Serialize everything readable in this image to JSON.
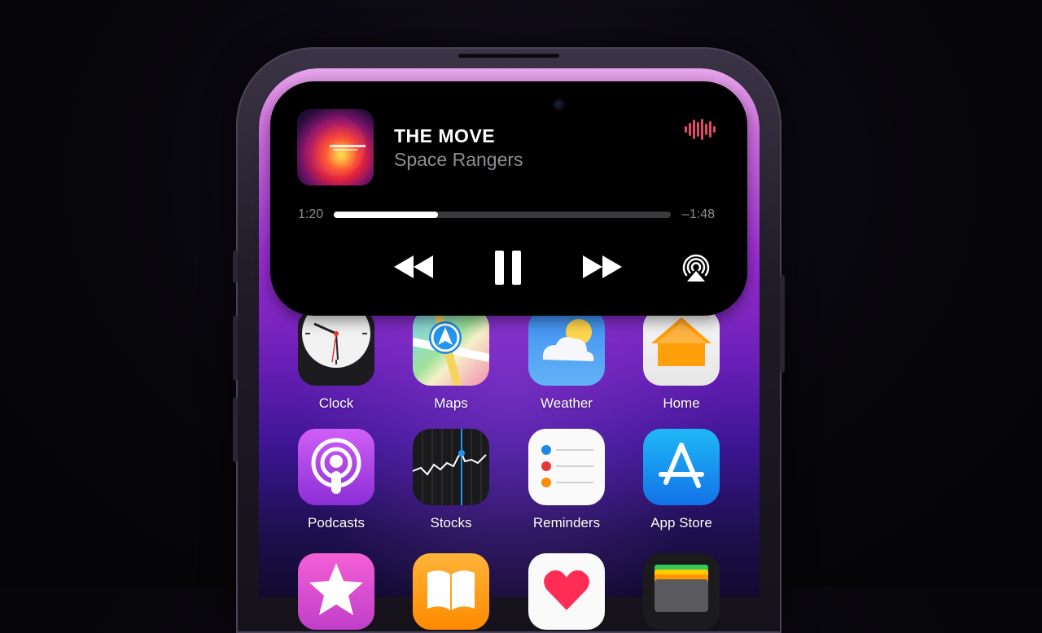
{
  "now_playing": {
    "title": "THE MOVE",
    "artist": "Space Rangers",
    "elapsed": "1:20",
    "remaining": "–1:48",
    "progress": 0.31,
    "controls": {
      "rewind_icon": "rewind-icon",
      "pause_icon": "pause-icon",
      "forward_icon": "fast-forward-icon",
      "airplay_icon": "airplay-icon"
    }
  },
  "home_screen": {
    "row1": [
      {
        "label": "Clock",
        "icon": "clock-icon"
      },
      {
        "label": "Maps",
        "icon": "maps-icon"
      },
      {
        "label": "Weather",
        "icon": "weather-icon"
      },
      {
        "label": "Home",
        "icon": "home-icon"
      }
    ],
    "row2": [
      {
        "label": "Podcasts",
        "icon": "podcasts-icon"
      },
      {
        "label": "Stocks",
        "icon": "stocks-icon"
      },
      {
        "label": "Reminders",
        "icon": "reminders-icon"
      },
      {
        "label": "App Store",
        "icon": "app-store-icon"
      }
    ],
    "row3": [
      {
        "icon": "itunes-store-icon"
      },
      {
        "icon": "books-icon"
      },
      {
        "icon": "health-icon"
      },
      {
        "icon": "wallet-icon"
      }
    ]
  },
  "colors": {
    "island_bg": "#000000",
    "scrubber_track": "#3a3a3c",
    "scrubber_fill": "#ffffff",
    "secondary_text": "#8e8e93",
    "waveform": "#e4486a"
  }
}
